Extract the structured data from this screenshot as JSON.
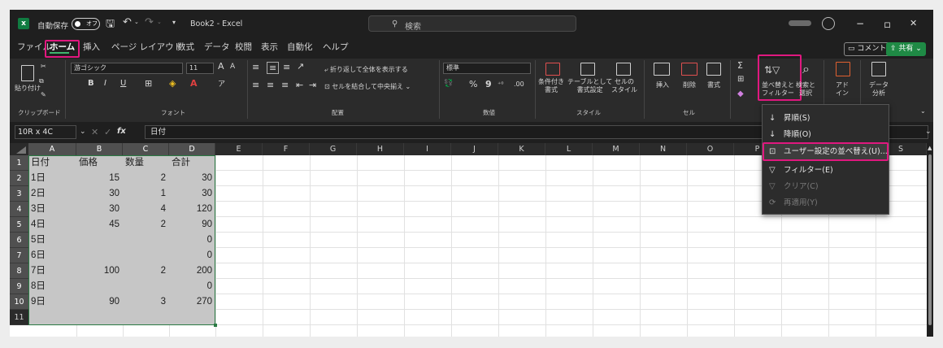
{
  "window": {
    "autosave_label": "自動保存",
    "autosave_state": "オフ",
    "title": "Book2 - Excel",
    "search_placeholder": "検索",
    "minimize": "−",
    "restore": "ロ",
    "close": "✕"
  },
  "tabs": [
    "ファイル",
    "ホーム",
    "挿入",
    "ページ レイアウト",
    "数式",
    "データ",
    "校閲",
    "表示",
    "自動化",
    "ヘルプ"
  ],
  "active_tab": "ホーム",
  "tab_buttons": {
    "comment": "コメント",
    "share": "共有"
  },
  "ribbon": {
    "clipboard": {
      "paste": "貼り付け",
      "label": "クリップボード"
    },
    "font": {
      "name": "游ゴシック",
      "size": "11",
      "label": "フォント",
      "grow": "A",
      "shrink": "A",
      "bold": "B",
      "italic": "I",
      "underline": "U"
    },
    "alignment": {
      "wrap": "折り返して全体を表示する",
      "merge": "セルを結合して中央揃え",
      "label": "配置"
    },
    "number": {
      "format": "標準",
      "percent": "%",
      "comma": "9",
      "label": "数値"
    },
    "styles": {
      "conditional": "条件付き\n書式",
      "table": "テーブルとして\n書式設定",
      "cell": "セルの\nスタイル",
      "label": "スタイル"
    },
    "cells": {
      "insert": "挿入",
      "delete": "削除",
      "format": "書式",
      "label": "セル"
    },
    "editing": {
      "sort_filter": "並べ替えと\nフィルター",
      "find": "検索と\n選択"
    },
    "addins": {
      "label": "アド\nイン"
    },
    "analysis": {
      "label": "データ\n分析"
    }
  },
  "formula_bar": {
    "name_box": "10R x 4C",
    "fx": "fx",
    "content": "日付"
  },
  "columns": [
    "A",
    "B",
    "C",
    "D",
    "E",
    "F",
    "G",
    "H",
    "I",
    "J",
    "K",
    "L",
    "M",
    "N",
    "O",
    "P",
    "Q",
    "R",
    "S"
  ],
  "rows": [
    "1",
    "2",
    "3",
    "4",
    "5",
    "6",
    "7",
    "8",
    "9",
    "10",
    "11"
  ],
  "sheet": {
    "headers": [
      "日付",
      "価格",
      "数量",
      "合計"
    ],
    "data": [
      [
        " 1日",
        "15",
        "2",
        "30"
      ],
      [
        "2日",
        "30",
        "1",
        "30"
      ],
      [
        "3日",
        "30",
        "4",
        "120"
      ],
      [
        " 4日",
        "45",
        "2",
        "90"
      ],
      [
        " 5日",
        "",
        "",
        "0"
      ],
      [
        "6日",
        "",
        "",
        "0"
      ],
      [
        "7日",
        "100",
        "2",
        "200"
      ],
      [
        "8日",
        "",
        "",
        "0"
      ],
      [
        "9日",
        "90",
        "3",
        "270"
      ]
    ]
  },
  "sort_menu": {
    "asc": "昇順(S)",
    "desc": "降順(O)",
    "custom": "ユーザー設定の並べ替え(U)...",
    "filter": "フィルター(E)",
    "clear": "クリア(C)",
    "reapply": "再適用(Y)"
  },
  "colors": {
    "excel_green": "#107c41",
    "highlight": "#e0187f",
    "selection": "#c6c6c6",
    "share": "#1f8a45"
  }
}
